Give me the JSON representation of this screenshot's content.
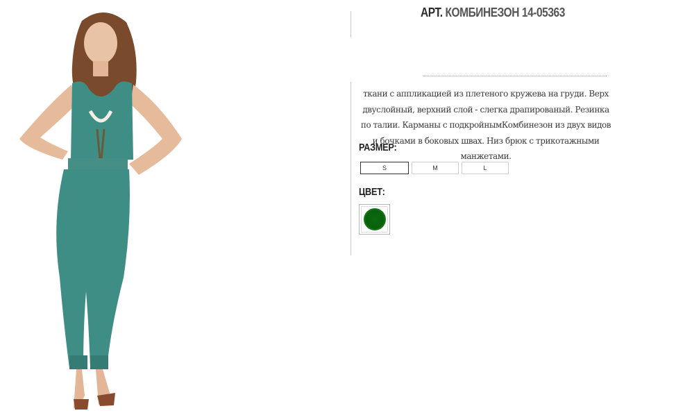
{
  "product": {
    "title_prefix": "АРТ.",
    "title_name": "КОМБИНЕЗОН 14-05363",
    "photo_alt": "",
    "description": "ткани с аппликацией из плетеного кружева на груди. Верх двуслойный, верхний слой - слегка драпированый. Резинка по талии. Карманы с подкройнымКомбинезон из двух видов и бочками в боковых швах. Низ брюк с трикотажными манжетами."
  },
  "size": {
    "label": "РАЗМЕР:",
    "options": [
      "S",
      "M",
      "L"
    ],
    "selected": "S"
  },
  "color": {
    "label": "ЦВЕТ:",
    "swatch_color": "#086108"
  },
  "colors": {
    "text": "#333333",
    "divider": "#c8c8c8",
    "jumpsuit": "#3f8e86",
    "swatch_green": "#086108"
  }
}
